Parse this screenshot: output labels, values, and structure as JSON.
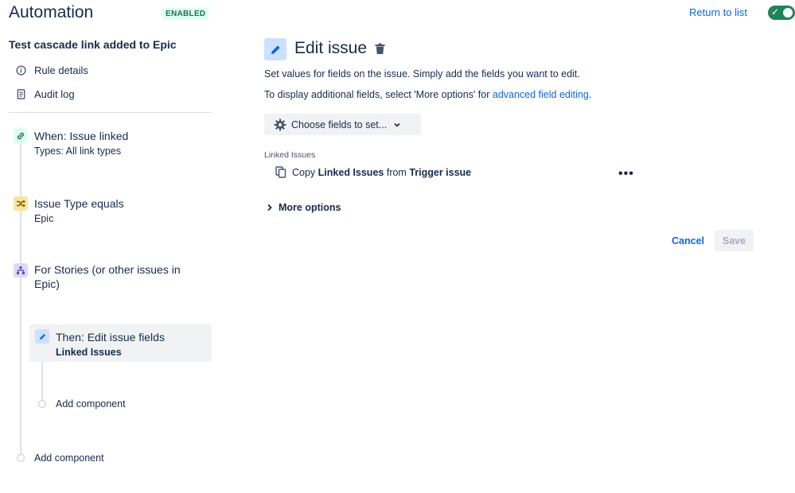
{
  "header": {
    "app_title": "Automation",
    "status_badge": "ENABLED",
    "return_link": "Return to list",
    "toggle_checkmark": "✓"
  },
  "sidebar": {
    "rule_name": "Test cascade link added to Epic",
    "nav": [
      {
        "label": "Rule details",
        "icon": "info-icon"
      },
      {
        "label": "Audit log",
        "icon": "document-icon"
      }
    ],
    "steps": [
      {
        "title": "When: Issue linked",
        "subtitle": "Types: All link types",
        "icon": "link-icon",
        "color": "#dcfff1"
      },
      {
        "title": "Issue Type equals",
        "subtitle": "Epic",
        "icon": "shuffle-icon",
        "color": "#f8e6a0"
      },
      {
        "title": "For Stories (or other issues in",
        "title_line2": "Epic)",
        "icon": "hierarchy-icon",
        "color": "#dfd8fd"
      },
      {
        "title": "Then: Edit issue fields",
        "subtitle": "Linked Issues",
        "icon": "pencil-icon",
        "color": "#cce0ff"
      }
    ],
    "add_component_inner": "Add component",
    "add_component_outer": "Add component"
  },
  "panel": {
    "title": "Edit issue",
    "description1": "Set values for fields on the issue. Simply add the fields you want to edit.",
    "description2_prefix": "To display additional fields, select 'More options' for ",
    "description2_link": "advanced field editing",
    "description2_suffix": ".",
    "choose_fields": "Choose fields to set...",
    "field_label": "Linked Issues",
    "field_copy_prefix": "Copy ",
    "field_copy_field": "Linked Issues",
    "field_copy_middle": " from ",
    "field_copy_source": "Trigger issue",
    "more_menu": "•••",
    "more_options": "More options",
    "cancel": "Cancel",
    "save": "Save"
  },
  "colors": {
    "accent": "#0c66e4",
    "toggle_on": "#1f845a",
    "badge_bg": "#dcfff1",
    "badge_text": "#216e4e"
  }
}
